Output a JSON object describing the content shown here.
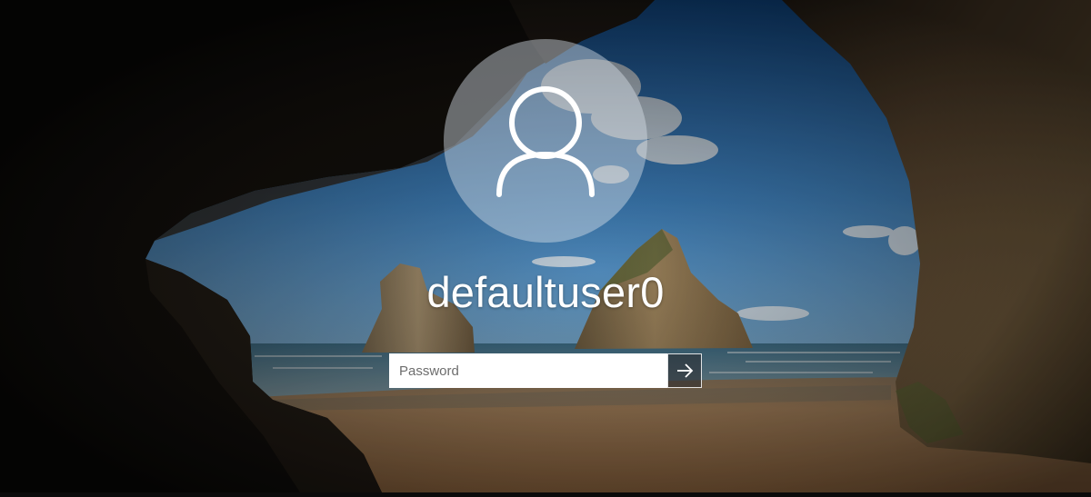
{
  "lock_screen": {
    "background": {
      "description_icon": "cave-beach-wallpaper",
      "sky_color": "#2f78c0",
      "sand_color": "#b98a5b",
      "cave_color": "#0c0b09"
    },
    "user": {
      "avatar_icon": "person-outline-icon",
      "name": "defaultuser0"
    },
    "password": {
      "placeholder": "Password",
      "value": ""
    },
    "submit": {
      "icon": "arrow-right-icon"
    }
  }
}
